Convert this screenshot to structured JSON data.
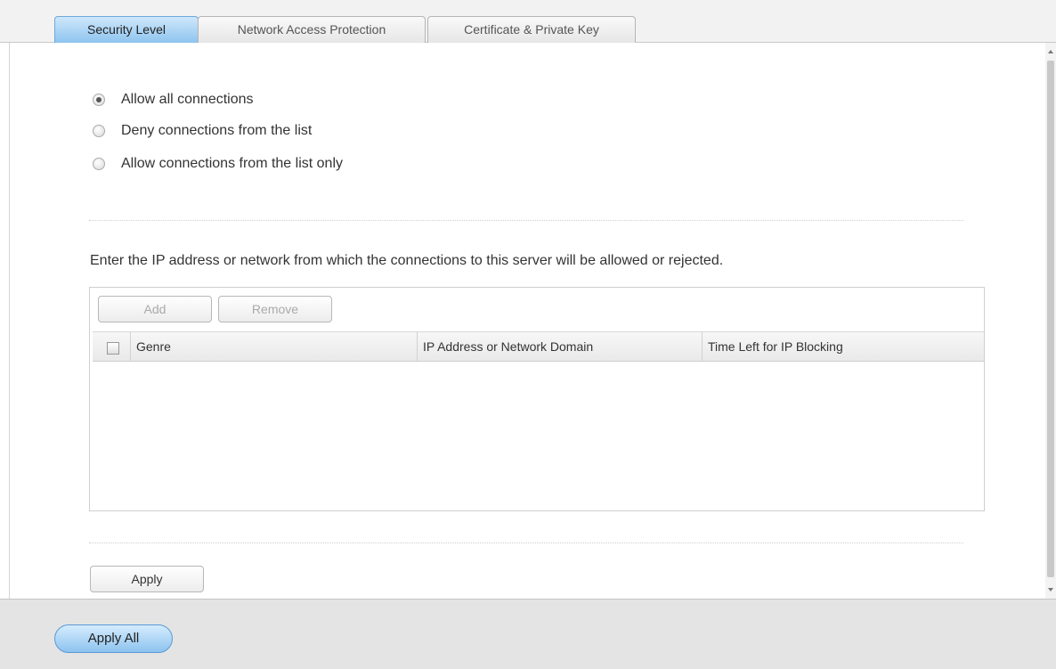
{
  "tabs": [
    {
      "label": "Security Level",
      "active": true
    },
    {
      "label": "Network Access Protection",
      "active": false
    },
    {
      "label": "Certificate & Private Key",
      "active": false
    }
  ],
  "security_options": [
    {
      "label": "Allow all connections",
      "selected": true
    },
    {
      "label": "Deny connections from the list",
      "selected": false
    },
    {
      "label": "Allow connections from the list only",
      "selected": false
    }
  ],
  "description": "Enter the IP address or network from which the connections to this server will be allowed or rejected.",
  "list_toolbar": {
    "add_label": "Add",
    "remove_label": "Remove"
  },
  "table": {
    "columns": [
      "Genre",
      "IP Address or Network Domain",
      "Time Left for IP Blocking"
    ],
    "rows": []
  },
  "apply_label": "Apply",
  "apply_all_label": "Apply All",
  "colors": {
    "accent": "#8ec4ef",
    "panel_bg": "#ffffff",
    "footer_bg": "#e4e4e4"
  }
}
